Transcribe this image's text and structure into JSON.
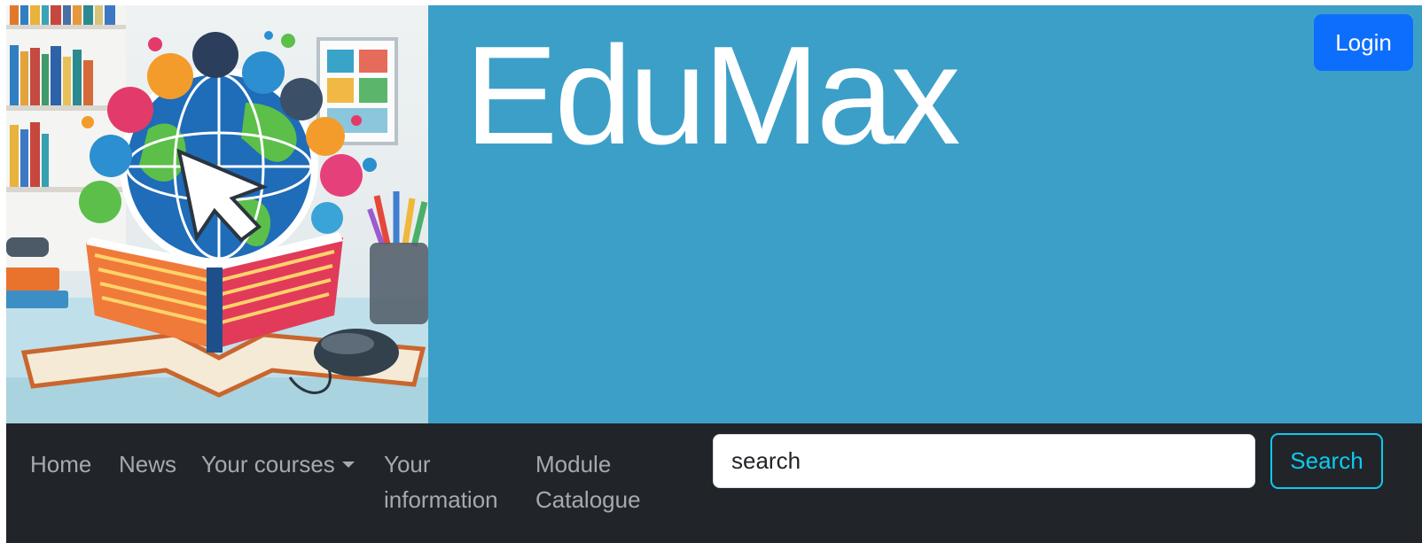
{
  "header": {
    "brand_title": "EduMax",
    "login_label": "Login"
  },
  "nav": {
    "items": [
      {
        "label": "Home"
      },
      {
        "label": "News"
      },
      {
        "label": "Your courses"
      },
      {
        "label": "Your information"
      },
      {
        "label": "Module Catalogue"
      }
    ],
    "dropdown_icon": "caret-down-icon"
  },
  "search": {
    "placeholder": "search",
    "button_label": "Search"
  },
  "colors": {
    "banner_bg": "#3c9fc8",
    "navbar_bg": "#212529",
    "login_bg": "#0d6efd",
    "search_outline": "#0dcaf0",
    "nav_link": "#a6a9ad"
  }
}
